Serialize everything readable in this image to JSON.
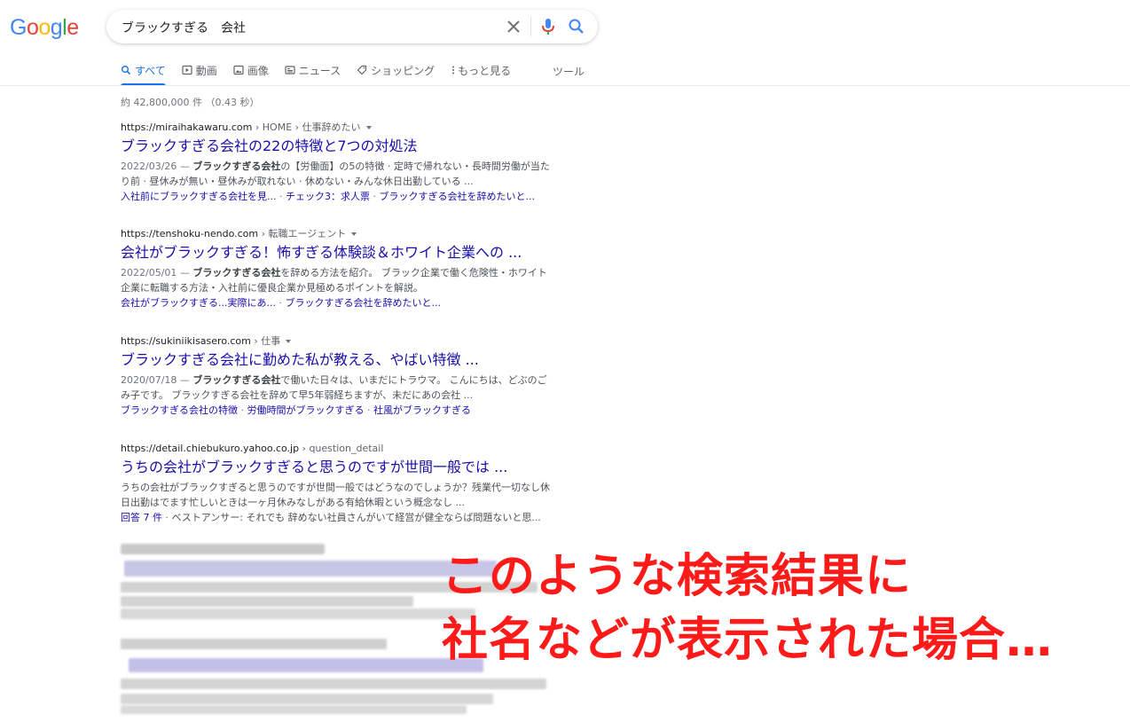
{
  "logo": {
    "text": "Google",
    "letters": [
      "G",
      "o",
      "o",
      "g",
      "l",
      "e"
    ],
    "colors": [
      "#4285F4",
      "#EA4335",
      "#FBBC05",
      "#4285F4",
      "#34A853",
      "#EA4335"
    ]
  },
  "search": {
    "query": "ブラックすぎる　会社"
  },
  "tabs": [
    {
      "label": "すべて",
      "icon": "search-icon",
      "active": true
    },
    {
      "label": "動画",
      "icon": "video-icon"
    },
    {
      "label": "画像",
      "icon": "image-icon"
    },
    {
      "label": "ニュース",
      "icon": "news-icon"
    },
    {
      "label": "ショッピング",
      "icon": "tag-icon"
    },
    {
      "label": "もっと見る",
      "icon": "more-vert-icon"
    }
  ],
  "tools_label": "ツール",
  "result_stats": "約 42,800,000 件 （0.43 秒）",
  "results": [
    {
      "domain": "https://miraihakawaru.com",
      "crumbs": " › HOME › 仕事辞めたい",
      "title": "ブラックすぎる会社の22の特徴と7つの対処法",
      "date": "2022/03/26 — ",
      "snippet_bold": "ブラックすぎる会社",
      "snippet_rest": "の【労働面】の5の特徴 · 定時で帰れない・長時間労働が当たり前 · 昼休みが無い・昼休みが取れない · 休めない・みんな休日出勤している ...",
      "links": [
        "入社前にブラックすぎる会社を見...",
        "チェック3：求人票",
        "ブラックすぎる会社を辞めたいと..."
      ]
    },
    {
      "domain": "https://tenshoku-nendo.com",
      "crumbs": " › 転職エージェント",
      "title": "会社がブラックすぎる！怖すぎる体験談＆ホワイト企業への ...",
      "date": "2022/05/01 — ",
      "snippet_bold": "ブラックすぎる会社",
      "snippet_rest": "を辞める方法を紹介。 ブラック企業で働く危険性・ホワイト企業に転職する方法・入社前に優良企業か見極めるポイントを解説。",
      "links": [
        "会社がブラックすぎる...実際にあ...",
        "ブラックすぎる会社を辞めたいと..."
      ]
    },
    {
      "domain": "https://sukiniikisasero.com",
      "crumbs": " › 仕事",
      "title": "ブラックすぎる会社に勤めた私が教える、やばい特徴 ...",
      "date": "2020/07/18 — ",
      "snippet_bold": "ブラックすぎる会社",
      "snippet_rest": "で働いた日々は、いまだにトラウマ。 こんにちは、どぶのごみ子です。 ブラックすぎる会社を辞めて早5年弱経ちますが、未だにあの会社 ...",
      "links": [
        "ブラックすぎる会社の特徴",
        "労働時間がブラックすぎる",
        "社風がブラックすぎる"
      ]
    },
    {
      "domain": "https://detail.chiebukuro.yahoo.co.jp",
      "crumbs": " › question_detail",
      "title": "うちの会社がブラックすぎると思うのですが世間一般では ...",
      "date": "",
      "snippet_bold": "",
      "snippet_rest": "うちの会社がブラックすぎると思うのですが世間一般ではどうなのでしょうか？残業代一切なし休日出勤はでます忙しいときは一ヶ月休みなしがある有給休暇という概念なし ...",
      "links": [
        "回答 7 件",
        "ベストアンサー: それでも 辞めない社員さんがいて経営が健全ならば問題ないと思..."
      ]
    }
  ],
  "caption": {
    "line1": "このような検索結果に",
    "line2": "社名などが表示された場合…"
  }
}
